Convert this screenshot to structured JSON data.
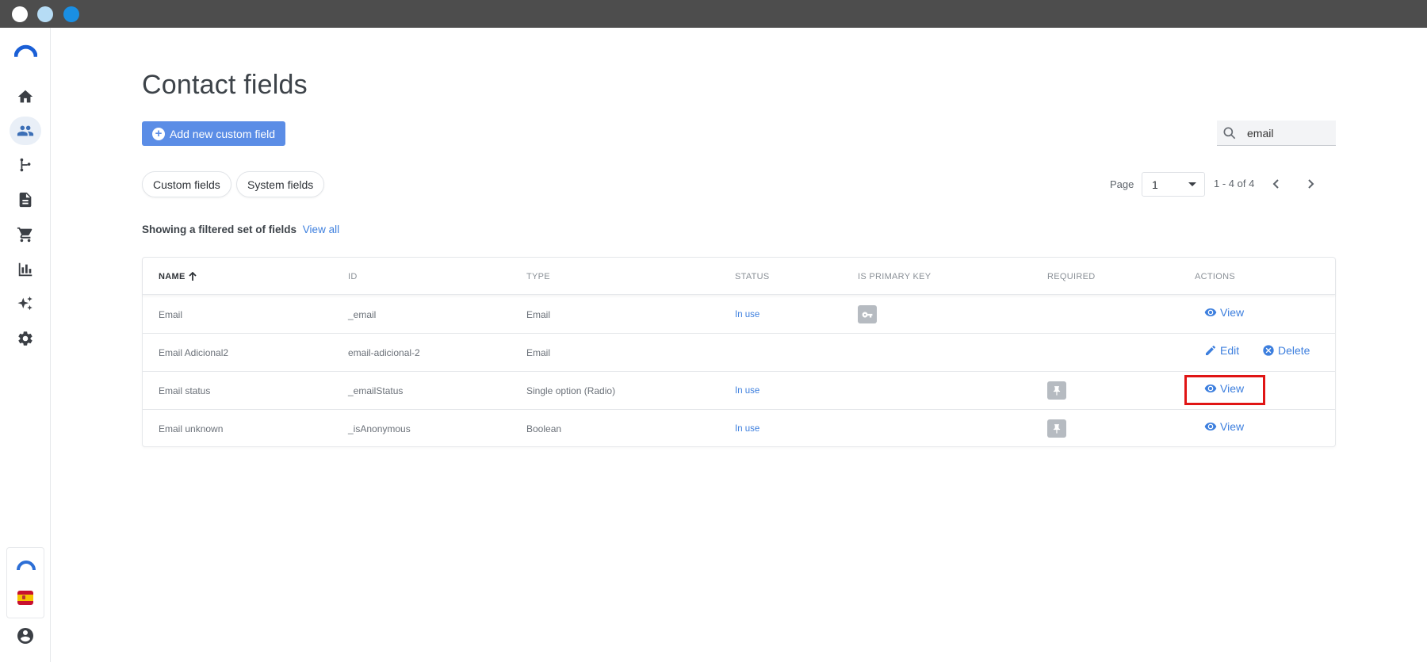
{
  "page": {
    "title": "Contact fields",
    "add_button": "Add new custom field",
    "search": {
      "value": "email",
      "placeholder": ""
    },
    "tabs": [
      "Custom fields",
      "System fields"
    ],
    "pager": {
      "label": "Page",
      "selected": "1",
      "range": "1 - 4 of 4"
    },
    "filter_note": {
      "text": "Showing a filtered set of fields",
      "link": "View all"
    }
  },
  "table": {
    "headers": [
      "NAME",
      "ID",
      "TYPE",
      "STATUS",
      "IS PRIMARY KEY",
      "REQUIRED",
      "ACTIONS"
    ],
    "rows": [
      {
        "name": "Email",
        "id": "_email",
        "type": "Email",
        "status": "In use",
        "primary_key": true,
        "required": false,
        "actions": [
          "View"
        ]
      },
      {
        "name": "Email Adicional2",
        "id": "email-adicional-2",
        "type": "Email",
        "status": "",
        "primary_key": false,
        "required": false,
        "actions": [
          "Edit",
          "Delete"
        ]
      },
      {
        "name": "Email status",
        "id": "_emailStatus",
        "type": "Single option (Radio)",
        "status": "In use",
        "primary_key": false,
        "required": true,
        "actions": [
          "View"
        ]
      },
      {
        "name": "Email unknown",
        "id": "_isAnonymous",
        "type": "Boolean",
        "status": "In use",
        "primary_key": false,
        "required": true,
        "actions": [
          "View"
        ]
      }
    ]
  },
  "colors": {
    "accent": "#5b8de6",
    "link": "#3d7fde",
    "highlight": "#e01515",
    "titlebar": "#4d4d4d"
  }
}
